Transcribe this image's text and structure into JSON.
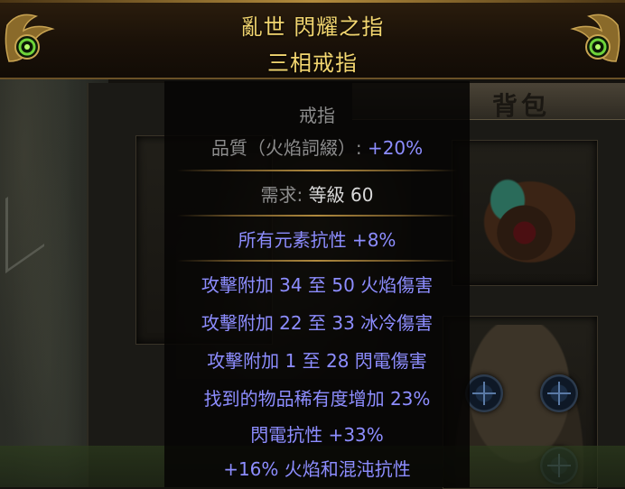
{
  "item": {
    "name_line1": "亂世 閃耀之指",
    "name_line2": "三相戒指",
    "type_label": "戒指",
    "quality_label": "品質（火焰詞綴）: ",
    "quality_value": "+20%",
    "requirement_label": "需求: ",
    "requirement_value": "等級 60",
    "implicit": "所有元素抗性 +8%",
    "mods": [
      "攻擊附加 34 至 50 火焰傷害",
      "攻擊附加 22 至 33 冰冷傷害",
      "攻擊附加 1 至 28 閃電傷害",
      "找到的物品稀有度增加 23%",
      "閃電抗性 +33%",
      "+16% 火焰和混沌抗性"
    ]
  },
  "inventory": {
    "title": "背包"
  },
  "colors": {
    "unique_name": "#f3d670",
    "magic_mod": "#8d8dff",
    "label_grey": "#8c8c8c",
    "value_white": "#d9d9d9"
  }
}
